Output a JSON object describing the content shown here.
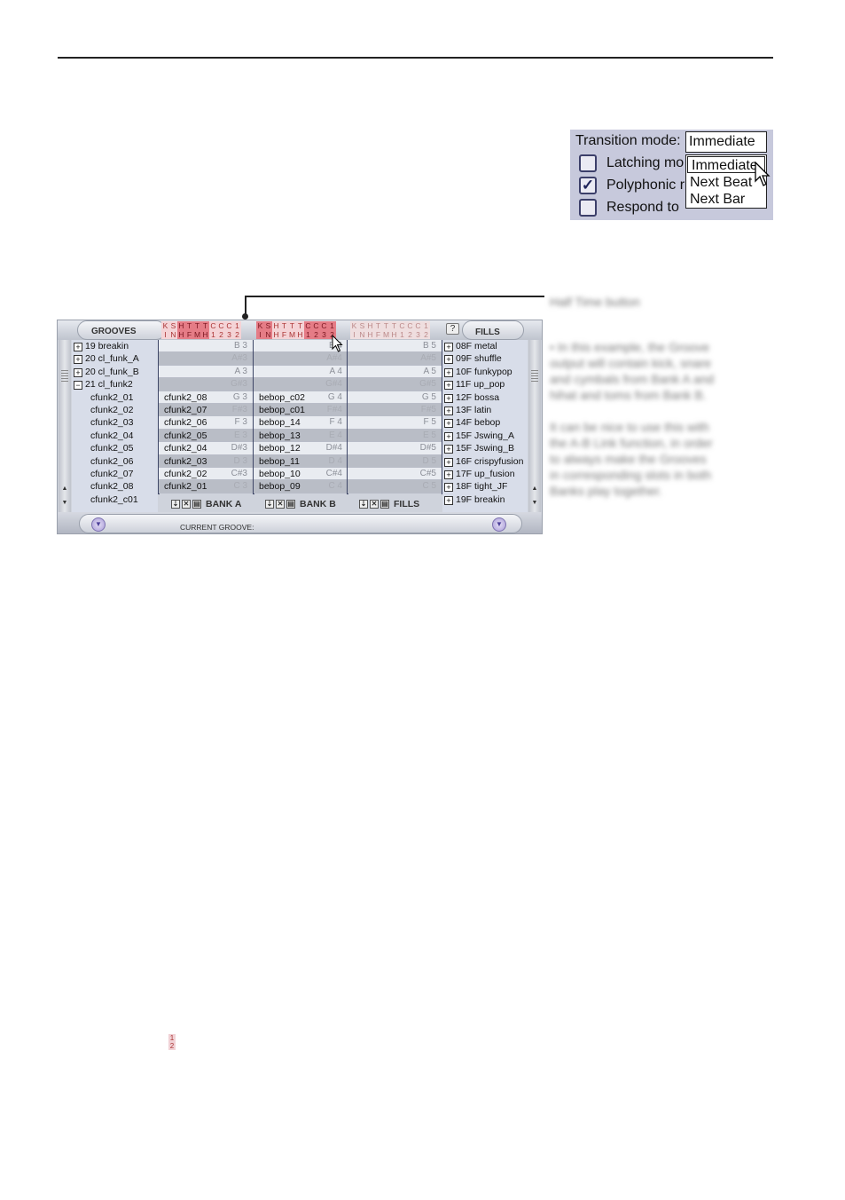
{
  "transition_panel": {
    "label": "Transition mode:",
    "selected": "Immediate",
    "options": [
      "Immediate",
      "Next Beat",
      "Next Bar"
    ],
    "checkboxes": [
      {
        "label": "Latching mo",
        "checked": false
      },
      {
        "label": "Polyphonic r",
        "checked": true
      },
      {
        "label": "Respond to",
        "checked": false
      }
    ],
    "check_mark": "✓"
  },
  "annotations": {
    "halftime_callout": "Half Time button",
    "note_lines": [
      "• In this example, the Groove",
      "output will contain kick, snare",
      "and cymbals from Bank A and",
      "hihat and toms from Bank B.",
      "",
      "It can be nice to use this with",
      "the A-B Link function, in order",
      "to always make the Grooves",
      "in corresponding slots in both",
      "Banks play together."
    ]
  },
  "editor": {
    "grooves_header": "GROOVES",
    "fills_header": "FILLS",
    "help_label": "?",
    "current_groove_label": "CURRENT GROOVE:",
    "key_groups": [
      {
        "top": [
          "K",
          "S",
          "H",
          "T",
          "T",
          "T",
          "C",
          "C",
          "C",
          "1"
        ],
        "bottom": [
          "I",
          "N",
          "H",
          "F",
          "M",
          "H",
          "1",
          "2",
          "3",
          "2"
        ],
        "on": [
          2,
          3,
          4,
          5
        ]
      },
      {
        "top": [
          "K",
          "S",
          "H",
          "T",
          "T",
          "T",
          "C",
          "C",
          "C",
          "1"
        ],
        "bottom": [
          "I",
          "N",
          "H",
          "F",
          "M",
          "H",
          "1",
          "2",
          "3",
          "2"
        ],
        "on": [
          0,
          1,
          6,
          7,
          8,
          9
        ]
      },
      {
        "top": [
          "K",
          "S",
          "H",
          "T",
          "T",
          "T",
          "C",
          "C",
          "C",
          "1"
        ],
        "bottom": [
          "I",
          "N",
          "H",
          "F",
          "M",
          "H",
          "1",
          "2",
          "3",
          "2"
        ],
        "on": []
      }
    ],
    "groove_tree": [
      {
        "type": "folder",
        "expander": "+",
        "label": "19 breakin"
      },
      {
        "type": "folder",
        "expander": "+",
        "label": "20 cl_funk_A"
      },
      {
        "type": "folder",
        "expander": "+",
        "label": "20 cl_funk_B"
      },
      {
        "type": "folder",
        "expander": "−",
        "label": "21 cl_funk2"
      },
      {
        "type": "child",
        "label": "cfunk2_01"
      },
      {
        "type": "child",
        "label": "cfunk2_02"
      },
      {
        "type": "child",
        "label": "cfunk2_03"
      },
      {
        "type": "child",
        "label": "cfunk2_04"
      },
      {
        "type": "child",
        "label": "cfunk2_05"
      },
      {
        "type": "child",
        "label": "cfunk2_06"
      },
      {
        "type": "child",
        "label": "cfunk2_07"
      },
      {
        "type": "child",
        "label": "cfunk2_08"
      },
      {
        "type": "child",
        "label": "cfunk2_c01"
      }
    ],
    "bank_a": [
      {
        "name": "",
        "key": "B 3"
      },
      {
        "name": "",
        "key": "A#3"
      },
      {
        "name": "",
        "key": "A 3"
      },
      {
        "name": "",
        "key": "G#3"
      },
      {
        "name": "cfunk2_08",
        "key": "G 3"
      },
      {
        "name": "cfunk2_07",
        "key": "F#3"
      },
      {
        "name": "cfunk2_06",
        "key": "F 3"
      },
      {
        "name": "cfunk2_05",
        "key": "E 3"
      },
      {
        "name": "cfunk2_04",
        "key": "D#3"
      },
      {
        "name": "cfunk2_03",
        "key": "D 3"
      },
      {
        "name": "cfunk2_02",
        "key": "C#3"
      },
      {
        "name": "cfunk2_01",
        "key": "C 3"
      }
    ],
    "bank_b": [
      {
        "name": "",
        "key": "B 4"
      },
      {
        "name": "",
        "key": "A#4"
      },
      {
        "name": "",
        "key": "A 4"
      },
      {
        "name": "",
        "key": "G#4"
      },
      {
        "name": "bebop_c02",
        "key": "G 4"
      },
      {
        "name": "bebop_c01",
        "key": "F#4"
      },
      {
        "name": "bebop_14",
        "key": "F 4"
      },
      {
        "name": "bebop_13",
        "key": "E 4"
      },
      {
        "name": "bebop_12",
        "key": "D#4"
      },
      {
        "name": "bebop_11",
        "key": "D 4"
      },
      {
        "name": "bebop_10",
        "key": "C#4"
      },
      {
        "name": "bebop_09",
        "key": "C 4"
      }
    ],
    "bank_fills": [
      {
        "name": "",
        "key": "B 5"
      },
      {
        "name": "",
        "key": "A#5"
      },
      {
        "name": "",
        "key": "A 5"
      },
      {
        "name": "",
        "key": "G#5"
      },
      {
        "name": "",
        "key": "G 5"
      },
      {
        "name": "",
        "key": "F#5"
      },
      {
        "name": "",
        "key": "F 5"
      },
      {
        "name": "",
        "key": "E 5"
      },
      {
        "name": "",
        "key": "D#5"
      },
      {
        "name": "",
        "key": "D 5"
      },
      {
        "name": "",
        "key": "C#5"
      },
      {
        "name": "",
        "key": "C 5"
      }
    ],
    "fills_tree": [
      "08F metal",
      "09F shuffle",
      "10F funkypop",
      "11F up_pop",
      "12F bossa",
      "13F latin",
      "14F bebop",
      "15F Jswing_A",
      "15F Jswing_B",
      "16F crispyfusion",
      "17F up_fusion",
      "18F tight_JF",
      "19F breakin"
    ],
    "bank_tools": [
      {
        "label": "BANK A"
      },
      {
        "label": "BANK B"
      },
      {
        "label": "FILLS"
      }
    ],
    "tool_glyphs": [
      "⇣",
      "✕",
      "▤"
    ]
  },
  "tiny_key": {
    "top": "1",
    "bottom": "2"
  }
}
